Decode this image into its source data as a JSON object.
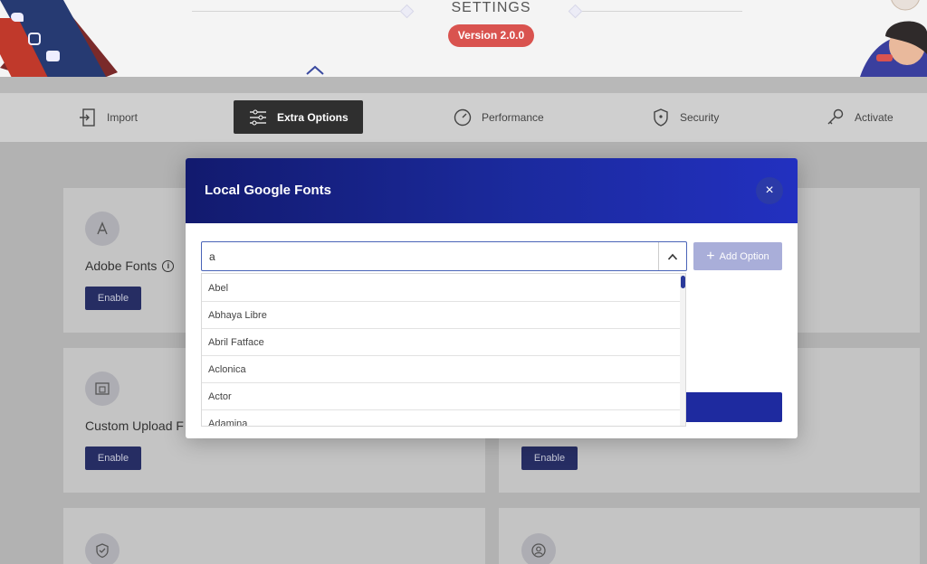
{
  "header": {
    "title": "SETTINGS",
    "version": "Version 2.0.0"
  },
  "tabs": [
    {
      "label": "Import",
      "icon": "import-icon"
    },
    {
      "label": "Extra Options",
      "icon": "sliders-icon",
      "active": true
    },
    {
      "label": "Performance",
      "icon": "speedometer-icon"
    },
    {
      "label": "Security",
      "icon": "shield-icon"
    },
    {
      "label": "Activate",
      "icon": "key-icon"
    }
  ],
  "cards": {
    "adobe_fonts": {
      "title": "Adobe Fonts",
      "button": "Enable"
    },
    "custom_upload": {
      "title": "Custom Upload F",
      "button": "Enable"
    },
    "right_card": {
      "button": "Enable"
    }
  },
  "modal": {
    "title": "Local Google Fonts",
    "search": {
      "value": "a"
    },
    "add_option_label": "Add Option",
    "close_label": "×",
    "options": [
      "Abel",
      "Abhaya Libre",
      "Abril Fatface",
      "Aclonica",
      "Actor",
      "Adamina"
    ]
  },
  "colors": {
    "accent": "#1b2a9e",
    "badge": "#d9534f",
    "enable_button": "#262d63"
  }
}
